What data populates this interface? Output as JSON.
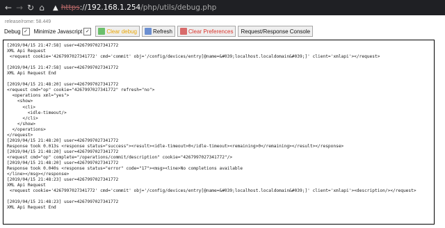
{
  "browser": {
    "back_icon": "arrow-left-icon",
    "forward_icon": "arrow-right-icon",
    "reload_icon": "reload-icon",
    "home_icon": "home-icon",
    "security_icon": "warning-icon",
    "url_protocol": "https",
    "url_sep": "://",
    "url_host": "192.168.1.254",
    "url_path": "/php/utils/debug.php"
  },
  "header": {
    "release_text": "release/rome: 58.449"
  },
  "toolbar": {
    "debug_label": "Debug",
    "debug_checked": "✓",
    "minimize_js_label": "Minimize Javascript",
    "minimize_js_checked": "✓",
    "clear_debug_label": "Clear debug",
    "refresh_label": "Refresh",
    "clear_prefs_label": "Clear Preferences",
    "console_label": "Request/Response Console"
  },
  "log": {
    "lines": [
      "[2019/04/15 21:47:58] user=4267997027341772",
      "XML Api Request",
      " <request cookie='4267997027341772' cmd='commit' obj='/config/devices/entry[@name=&#039;localhost.localdomain&#039;]' client='xmlapi'></request>",
      "",
      "[2019/04/15 21:47:58] user=4267997027341772",
      "XML Api Request End",
      "",
      "[2019/04/15 21:48:20] user=4267997027341772",
      "<request cmd=\"op\" cookie=\"4267997027341772\" refresh=\"no\">",
      "  <operations xml=\"yes\">",
      "    <show>",
      "      <cli>",
      "        <idle-timeout/>",
      "      </cli>",
      "    </show>",
      "  </operations>",
      "</request>",
      "[2019/04/15 21:48:20] user=4267997027341772",
      "Response took 0.013s <response status=\"success\"><result><idle-timeout>0</idle-timeout><remaining>0</remaining></result></response>",
      "[2019/04/15 21:48:20] user=4267997027341772",
      "<request cmd=\"op\" complete=\"/operations/commit/description\" cookie=\"4267997027341772\"/>",
      "[2019/04/15 21:48:20] user=4267997027341772",
      "Response took 0.040s <response status=\"error\" code=\"17\"><msg><line>No completions available",
      "</line></msg></response>",
      "[2019/04/15 21:48:23] user=4267997027341772",
      "XML Api Request",
      " <request cookie='4267997027341772' cmd='commit' obj='/config/devices/entry[@name=&#039;localhost.localdomain&#039;]' client='xmlapi'><description/></request>",
      "",
      "[2019/04/15 21:48:23] user=4267997027341772",
      "XML Api Request End"
    ]
  }
}
